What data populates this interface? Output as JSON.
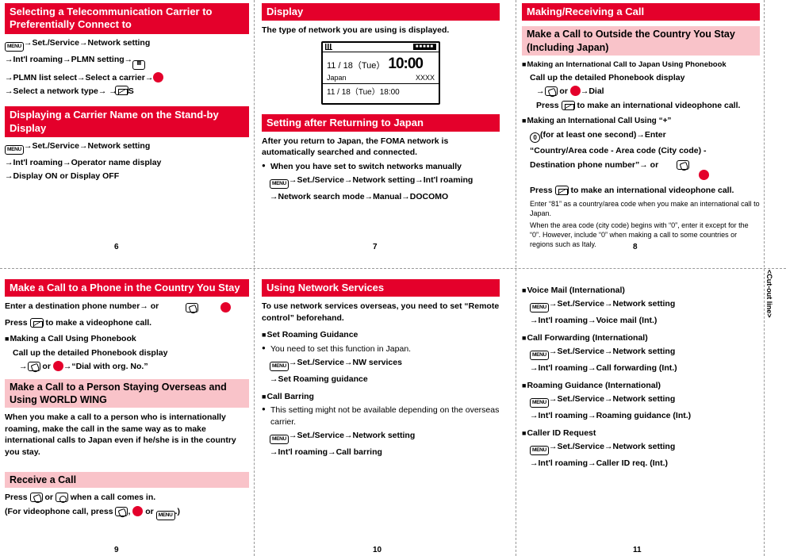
{
  "cutout_label": "<Cut-out line>",
  "page_numbers": {
    "p6": "6",
    "p7": "7",
    "p8": "8",
    "p9": "9",
    "p10": "10",
    "p11": "11"
  },
  "p6": {
    "title": "Selecting a Telecommunication Carrier to Preferentially Connect to",
    "lines": [
      "→Set./Service→Network setting",
      "→Int'l roaming→PLMN setting→",
      "→PLMN list select→Select a carrier→",
      "→Select a network type→    →YES"
    ],
    "section2_title": "Displaying a Carrier Name on the Stand-by Display",
    "section2_lines": [
      "→Set./Service→Network setting",
      "→Int'l roaming→Operator name display",
      "→Display ON or Display OFF"
    ]
  },
  "p7": {
    "title": "Display",
    "intro": "The type of network you are using is displayed.",
    "phone": {
      "date": "11 / 18（Tue）",
      "time": "10:00",
      "label_left": "Japan",
      "label_right": "XXXX",
      "bottom": "11 / 18（Tue）18:00",
      "badge": "■■■■■"
    },
    "section2_title": "Setting after Returning to Japan",
    "section2_intro": "After you return to Japan, the FOMA network is automatically searched and connected.",
    "bullet": "When you have set to switch networks manually",
    "lines": [
      "→Set./Service→Network setting→Int'l roaming",
      "→Network search mode→Manual→DOCOMO"
    ]
  },
  "p8": {
    "title": "Making/Receiving a Call",
    "section1_title": "Make a Call to Outside the Country You Stay (Including Japan)",
    "blk1": "Making an International Call to Japan Using Phonebook",
    "blk1_l1": "Call up the detailed Phonebook display",
    "blk1_l2": "→    or    →Dial",
    "blk1_l3": "Press        to make an international videophone call.",
    "blk2": "Making an International Call Using “+”",
    "blk2_l1": "(for at least one second)→Enter",
    "blk2_l2": "“Country/Area code - Area code (City code) -",
    "blk2_l3": "Destination phone number”→    or",
    "blk2_l4": "Press        to make an international videophone call.",
    "note1": "Enter “81” as a country/area code when you make an international call to Japan.",
    "note2": "When the area code (city code) begins with “0”, enter it except for the “0”. However, include “0” when making a call to some countries or regions such as Italy."
  },
  "p9": {
    "title": "Make a Call to a Phone in the Country You Stay",
    "l1": "Enter a destination phone number→    or",
    "l2": "Press        to make a videophone call.",
    "blk1": "Making a Call Using Phonebook",
    "blk1_l1": "Call up the detailed Phonebook display",
    "blk1_l2": "→    or    →“Dial with org. No.”",
    "section2_title": "Make a Call to a Person Staying Overseas and Using WORLD WING",
    "section2_body": "When you make a call to a person who is internationally roaming, make the call in the same way as to make international calls to Japan even if he/she is in the country you stay.",
    "section3_title": "Receive a Call",
    "s3_l1": "Press    or     when a call comes in.",
    "s3_l2": "(For videophone call, press    ,    or      .)"
  },
  "p10": {
    "title": "Using Network Services",
    "intro": "To use network services overseas, you need to set “Remote control” beforehand.",
    "blk1": "Set Roaming Guidance",
    "blk1_bullet": "You need to set this function in Japan.",
    "blk1_l1": "→Set./Service→NW services",
    "blk1_l2": "→Set Roaming guidance",
    "blk2": "Call Barring",
    "blk2_bullet": "This setting might not be available depending on the overseas carrier.",
    "blk2_l1": "→Set./Service→Network setting",
    "blk2_l2": "→Int'l roaming→Call barring"
  },
  "p11": {
    "blocks": [
      {
        "title": "Voice Mail (International)",
        "l1": "→Set./Service→Network setting",
        "l2": "→Int'l roaming→Voice mail (Int.)"
      },
      {
        "title": "Call Forwarding (International)",
        "l1": "→Set./Service→Network setting",
        "l2": "→Int'l roaming→Call forwarding (Int.)"
      },
      {
        "title": "Roaming Guidance (International)",
        "l1": "→Set./Service→Network setting",
        "l2": "→Int'l roaming→Roaming guidance (Int.)"
      },
      {
        "title": "Caller ID Request",
        "l1": "→Set./Service→Network setting",
        "l2": "→Int'l roaming→Caller ID req. (Int.)"
      }
    ]
  },
  "keys": {
    "menu": "MENU",
    "zero": "0",
    "phonebook": "icon"
  }
}
